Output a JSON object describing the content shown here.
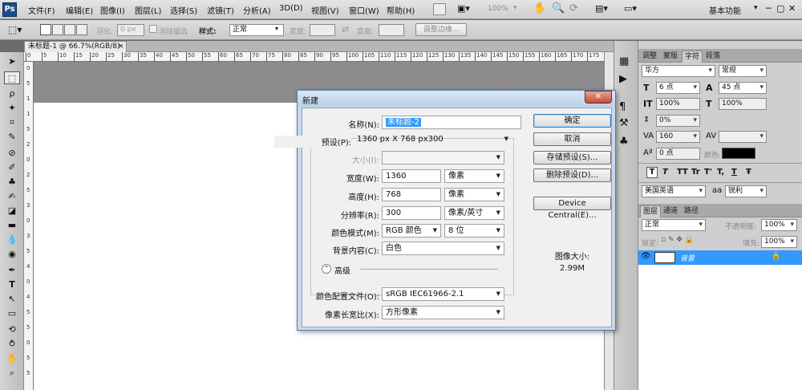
{
  "app": {
    "logo": "Ps"
  },
  "menu": [
    "文件(F)",
    "编辑(E)",
    "图像(I)",
    "图层(L)",
    "选择(S)",
    "滤镜(T)",
    "分析(A)",
    "3D(D)",
    "视图(V)",
    "窗口(W)",
    "帮助(H)"
  ],
  "menubar_right": {
    "zoom": "100%",
    "workspace": "基本功能"
  },
  "options": {
    "feather_label": "羽化:",
    "feather_value": "0 px",
    "antialias_label": "消除锯齿",
    "style_label": "样式:",
    "style_value": "正常",
    "width_label": "宽度:",
    "height_label": "高度:",
    "refine_button": "调整边缘..."
  },
  "document": {
    "tab_title": "未标题-1 @ 66.7%(RGB/8)"
  },
  "ruler": {
    "h": [
      "0",
      "5",
      "10",
      "15",
      "20",
      "25",
      "30",
      "35",
      "40",
      "45",
      "50",
      "55",
      "60",
      "65",
      "70",
      "75",
      "80",
      "85",
      "90",
      "95",
      "100",
      "105",
      "110",
      "115",
      "120",
      "125",
      "130",
      "135",
      "140",
      "145",
      "150",
      "155",
      "160",
      "165",
      "170",
      "175"
    ],
    "v": [
      "0",
      "5",
      "1",
      "1",
      "5",
      "2",
      "0",
      "2",
      "5",
      "3",
      "0",
      "3",
      "5",
      "4",
      "0",
      "4",
      "5",
      "5",
      "0",
      "5",
      "5"
    ]
  },
  "char_panel": {
    "tabs": [
      "调整",
      "蒙版",
      "字符",
      "段落"
    ],
    "font": "华方",
    "font_style": "常规",
    "size": "6 点",
    "leading": "45 点",
    "vscale": "100%",
    "hscale": "100%",
    "kerning": "0%",
    "tracking": "160",
    "baseline": "0 点",
    "color_label": "颜色:",
    "style_glyphs": [
      "T",
      "T",
      "TT",
      "Tr",
      "T'",
      "T,",
      "T",
      "Ŧ"
    ],
    "language": "美国英语",
    "aa_label": "aa",
    "aa_value": "锐利"
  },
  "layers_panel": {
    "tabs": [
      "图层",
      "通道",
      "路径"
    ],
    "blend_mode": "正常",
    "opacity_label": "不透明度:",
    "opacity_value": "100%",
    "lock_label": "锁定:",
    "fill_label": "填充:",
    "fill_value": "100%",
    "layer_name": "背景"
  },
  "dialog": {
    "title": "新建",
    "close": "✕",
    "name_label": "名称(N):",
    "name_value": "未标题-2",
    "preset_label": "预设(P):",
    "preset_value": "1360 px X 768 px300",
    "size_label": "大小(I):",
    "width_label": "宽度(W):",
    "width_value": "1360",
    "width_unit": "像素",
    "height_label": "高度(H):",
    "height_value": "768",
    "height_unit": "像素",
    "res_label": "分辨率(R):",
    "res_value": "300",
    "res_unit": "像素/英寸",
    "mode_label": "颜色模式(M):",
    "mode_value": "RGB 颜色",
    "depth_value": "8 位",
    "bg_label": "背景内容(C):",
    "bg_value": "白色",
    "advanced_label": "高级",
    "profile_label": "颜色配置文件(O):",
    "profile_value": "sRGB IEC61966-2.1",
    "aspect_label": "像素长宽比(X):",
    "aspect_value": "方形像素",
    "ok": "确定",
    "cancel": "取消",
    "save_preset": "存储预设(S)...",
    "delete_preset": "删除预设(D)...",
    "device_central": "Device Central(E)...",
    "image_size_label": "图像大小:",
    "image_size_value": "2.99M"
  },
  "colors": {
    "selection_blue": "#3399ff",
    "dialog_frame": "#c8d9ee"
  }
}
